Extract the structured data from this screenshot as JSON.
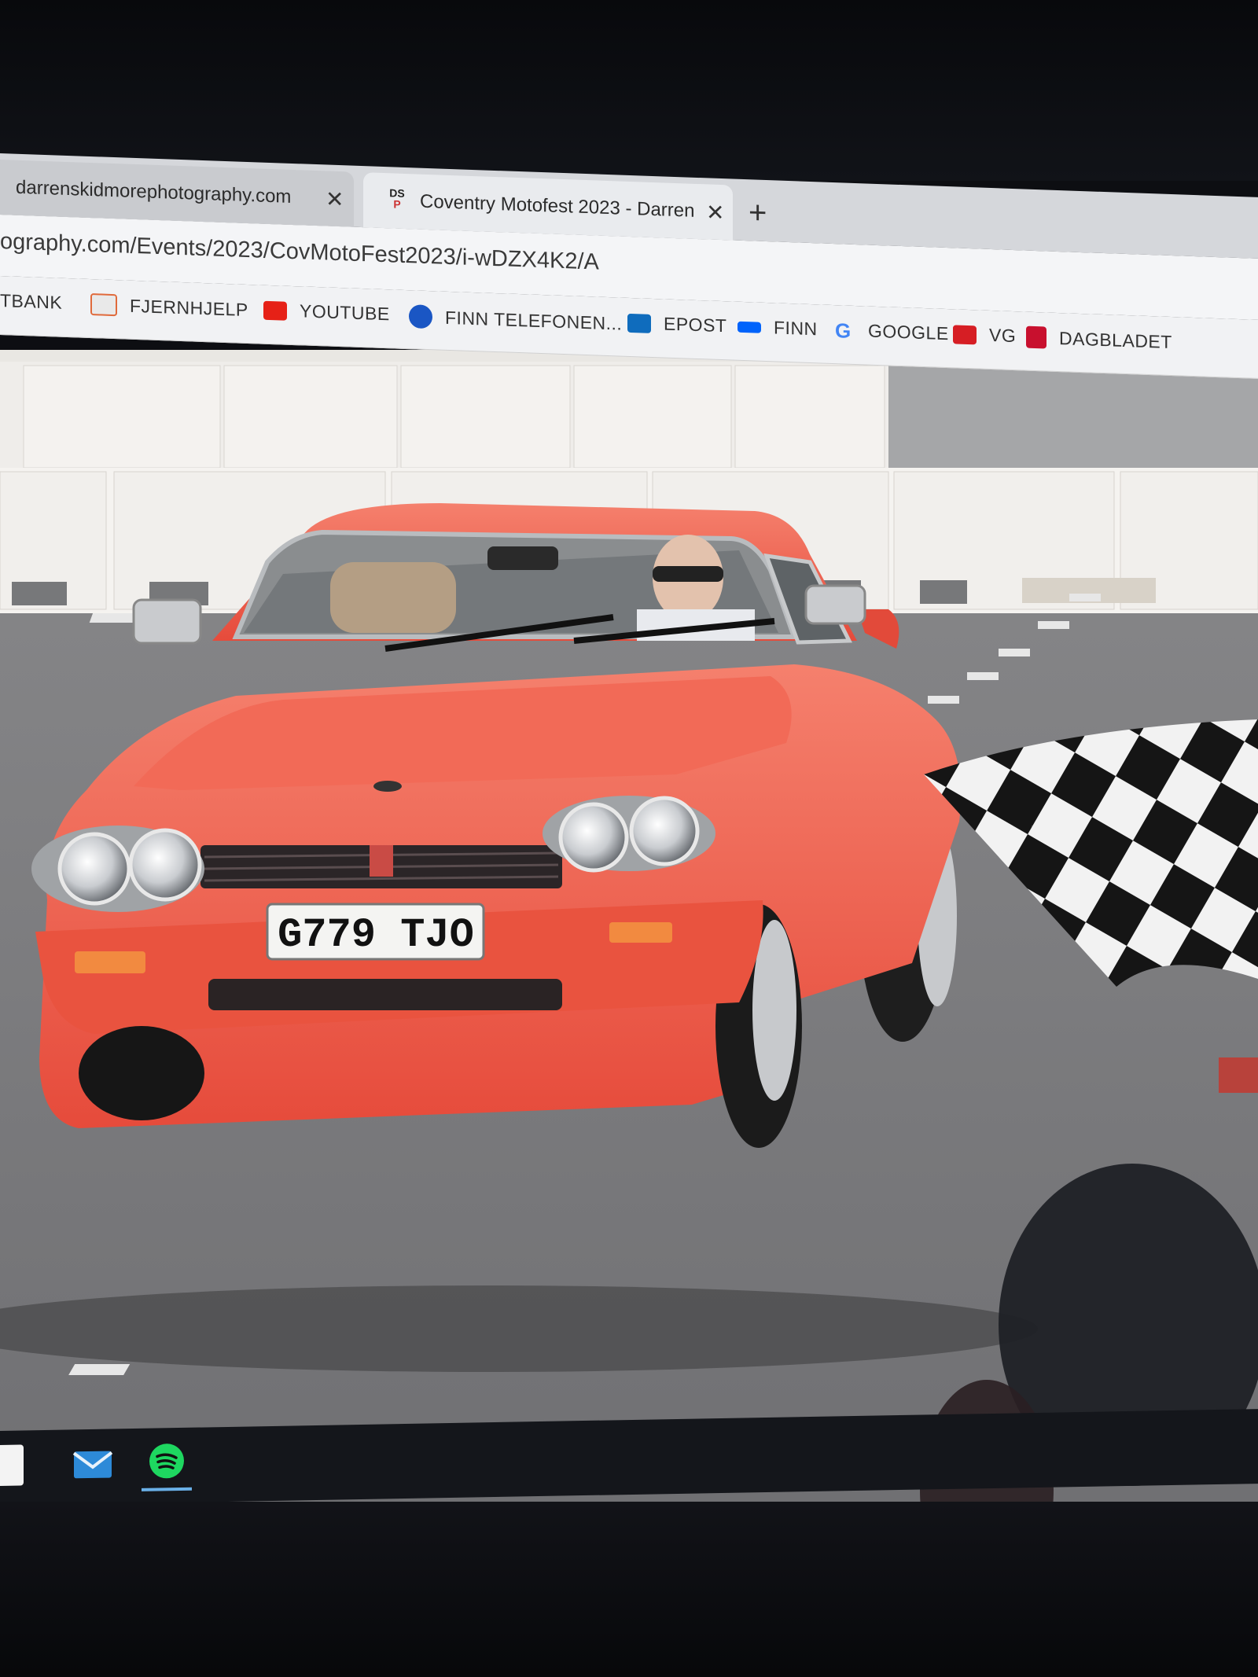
{
  "browser": {
    "tabs": [
      {
        "title": "darrenskidmorephotography.com",
        "active": false
      },
      {
        "title": "Coventry Motofest 2023 - Darren",
        "active": true,
        "favicon_text": "DS\nP"
      }
    ],
    "tab_close_glyph": "✕",
    "new_tab_glyph": "+",
    "url": "ography.com/Events/2023/CovMotoFest2023/i-wDZX4K2/A",
    "bookmarks": [
      {
        "label": "TBANK",
        "icon": "bank-icon",
        "color": "#ffffff"
      },
      {
        "label": "FJERNHJELP",
        "icon": "remote-help-icon",
        "color": "#e06a3b"
      },
      {
        "label": "YOUTUBE",
        "icon": "youtube-icon",
        "color": "#e62117"
      },
      {
        "label": "FINN TELEFONEN...",
        "icon": "location-pin-icon",
        "color": "#1a56c4"
      },
      {
        "label": "EPOST",
        "icon": "outlook-icon",
        "color": "#0f6cbd"
      },
      {
        "label": "FINN",
        "icon": "finn-icon",
        "color": "#0063fb"
      },
      {
        "label": "GOOGLE",
        "icon": "google-icon",
        "color": "#4285f4"
      },
      {
        "label": "VG",
        "icon": "vg-icon",
        "color": "#d61e24"
      },
      {
        "label": "DAGBLADET",
        "icon": "dagbladet-icon",
        "color": "#c8102e"
      }
    ]
  },
  "photo": {
    "license_plate": "G779 TJO",
    "car_color": "#f0604f"
  },
  "taskbar": {
    "icons": [
      {
        "name": "file-explorer-icon"
      },
      {
        "name": "mail-icon"
      },
      {
        "name": "spotify-icon"
      }
    ]
  }
}
